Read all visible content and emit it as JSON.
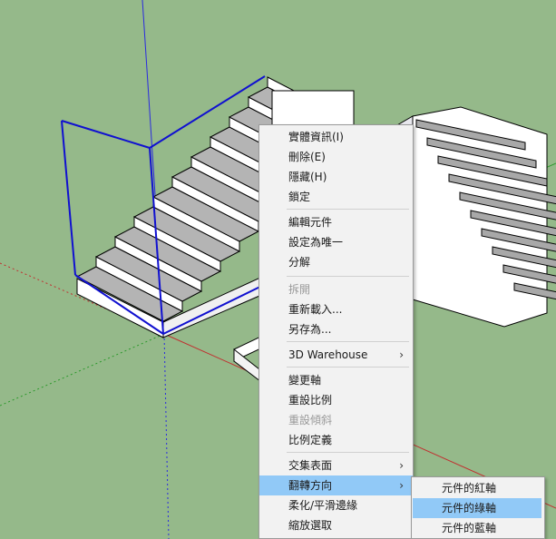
{
  "context_menu": {
    "items": [
      {
        "label": "實體資訊(I)",
        "enabled": true
      },
      {
        "label": "刪除(E)",
        "enabled": true
      },
      {
        "label": "隱藏(H)",
        "enabled": true
      },
      {
        "label": "鎖定",
        "enabled": true
      },
      {
        "label": "編輯元件",
        "enabled": true
      },
      {
        "label": "設定為唯一",
        "enabled": true
      },
      {
        "label": "分解",
        "enabled": true
      },
      {
        "label": "拆開",
        "enabled": false
      },
      {
        "label": "重新載入...",
        "enabled": true
      },
      {
        "label": "另存為...",
        "enabled": true
      },
      {
        "label": "3D Warehouse",
        "enabled": true,
        "submenu": true
      },
      {
        "label": "變更軸",
        "enabled": true
      },
      {
        "label": "重設比例",
        "enabled": true
      },
      {
        "label": "重設傾斜",
        "enabled": false
      },
      {
        "label": "比例定義",
        "enabled": true
      },
      {
        "label": "交集表面",
        "enabled": true,
        "submenu": true
      },
      {
        "label": "翻轉方向",
        "enabled": true,
        "submenu": true,
        "highlighted": true
      },
      {
        "label": "柔化/平滑邊緣",
        "enabled": true
      },
      {
        "label": "縮放選取",
        "enabled": true
      }
    ]
  },
  "flip_submenu": {
    "items": [
      {
        "label": "元件的紅軸"
      },
      {
        "label": "元件的綠軸",
        "highlighted": true
      },
      {
        "label": "元件的藍軸"
      }
    ]
  },
  "colors": {
    "background": "#95b98a",
    "selection": "#1010d0",
    "highlight": "#91c9f7"
  }
}
